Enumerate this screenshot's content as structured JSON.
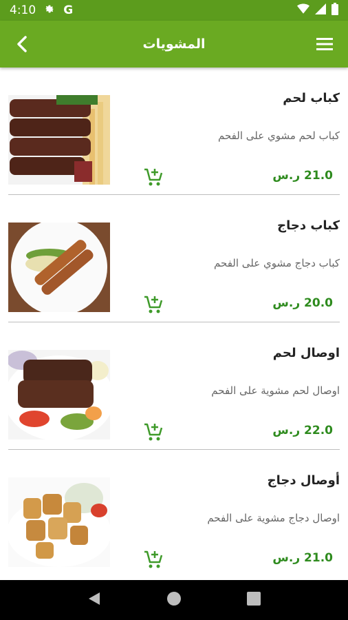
{
  "status": {
    "time": "4:10",
    "g_label": "G"
  },
  "app_bar": {
    "title": "المشويات"
  },
  "items": [
    {
      "name": "كباب لحم",
      "description": "كباب لحم مشوي على الفحم",
      "price": "21.0",
      "currency": "ر.س",
      "image": "beef-kebab"
    },
    {
      "name": "كباب دجاج",
      "description": "كباب دجاج مشوي على الفحم",
      "price": "20.0",
      "currency": "ر.س",
      "image": "chicken-kebab"
    },
    {
      "name": "اوصال لحم",
      "description": "اوصال لحم مشوية على الفحم",
      "price": "22.0",
      "currency": "ر.س",
      "image": "beef-cubes"
    },
    {
      "name": "أوصال دجاج",
      "description": "اوصال دجاج مشوية على الفحم",
      "price": "21.0",
      "currency": "ر.س",
      "image": "chicken-cubes"
    }
  ],
  "colors": {
    "status_bar": "#5c9c1d",
    "app_bar": "#6aaa22",
    "price": "#2e8b1e",
    "cart_icon": "#3f9a2a"
  }
}
